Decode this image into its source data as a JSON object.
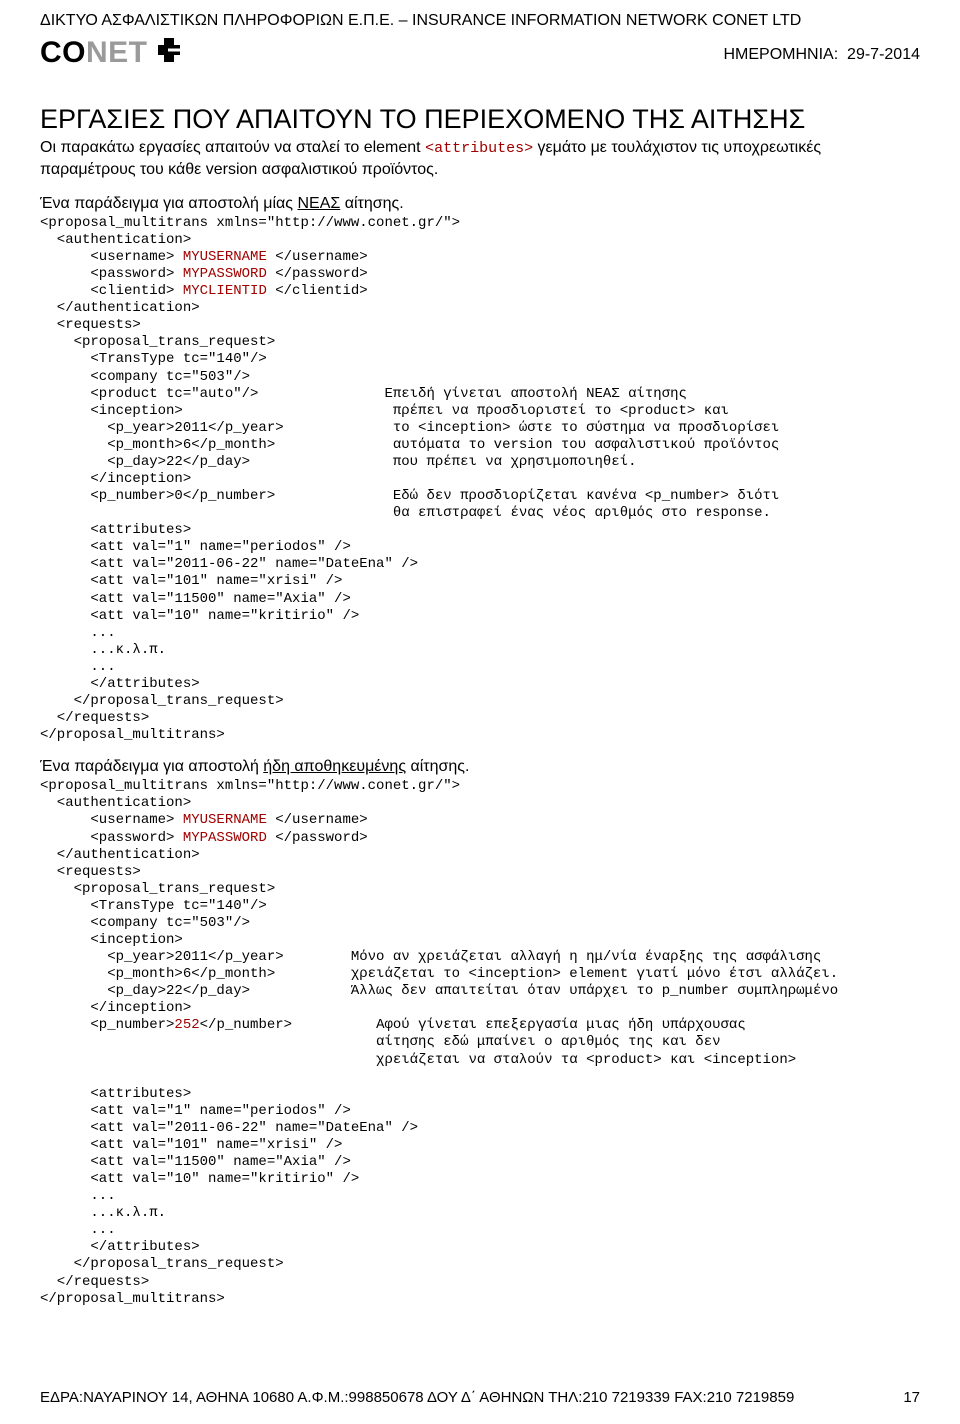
{
  "orgline": "ΔΙΚΤΥΟ ΑΣΦΑΛΙΣΤΙΚΩΝ ΠΛΗΡΟΦΟΡΙΩΝ Ε.Π.Ε. – INSURANCE INFORMATION NETWORK CONET LTD",
  "logo": {
    "part1": "CO",
    "part2": "NET"
  },
  "date": {
    "label": "ΗΜΕΡΟΜΗΝΙΑ:",
    "value": "29-7-2014"
  },
  "title": "ΕΡΓΑΣΙΕΣ ΠΟΥ ΑΠΑΙΤΟΥΝ ΤΟ ΠΕΡΙΕΧΟΜΕΝΟ ΤΗΣ ΑΙΤΗΣΗΣ",
  "intro": {
    "pre": "Οι παρακάτω εργασίες απαιτούν να σταλεί το element ",
    "code": "<attributes>",
    "post": " γεμάτο με τουλάχιστον τις υποχρεωτικές παραμέτρους του κάθε version ασφαλιστικού προϊόντος."
  },
  "example1": {
    "label_pre": "Ένα παράδειγμα για αποστολή μίας ",
    "label_u": "ΝΕΑΣ",
    "label_post": " αίτησης.",
    "code": "<proposal_multitrans xmlns=\"http://www.conet.gr/\">\n  <authentication>\n      <username> MYUSERNAME </username>\n      <password> MYPASSWORD </password>\n      <clientid> MYCLIENTID </clientid>\n  </authentication>\n  <requests>\n    <proposal_trans_request>\n      <TransType tc=\"140\"/>\n      <company tc=\"503\"/>\n      <product tc=\"auto\"/>               Επειδή γίνεται αποστολή ΝΕΑΣ αίτησης\n      <inception>                         πρέπει να προσδιοριστεί το <product> και\n        <p_year>2011</p_year>             το <inception> ώστε το σύστημα να προσδιορίσει\n        <p_month>6</p_month>              αυτόματα το version του ασφαλιστικού προϊόντος\n        <p_day>22</p_day>                 που πρέπει να χρησιμοποιηθεί.\n      </inception>\n      <p_number>0</p_number>              Εδώ δεν προσδιορίζεται κανένα <p_number> διότι\n                                          θα επιστραφεί ένας νέος αριθμός στο response.\n      <attributes>\n      <att val=\"1\" name=\"periodos\" />\n      <att val=\"2011-06-22\" name=\"DateEna\" />\n      <att val=\"101\" name=\"xrisi\" />\n      <att val=\"11500\" name=\"Axia\" />\n      <att val=\"10\" name=\"kritirio\" />\n      ...\n      ...κ.λ.π.\n      ...\n      </attributes>\n    </proposal_trans_request>\n  </requests>\n</proposal_multitrans>"
  },
  "example2": {
    "label_pre": "Ένα παράδειγμα για αποστολή ",
    "label_u": "ήδη αποθηκευμένης",
    "label_post": " αίτησης.",
    "code": "<proposal_multitrans xmlns=\"http://www.conet.gr/\">\n  <authentication>\n      <username> MYUSERNAME </username>\n      <password> MYPASSWORD </password>\n  </authentication>\n  <requests>\n    <proposal_trans_request>\n      <TransType tc=\"140\"/>\n      <company tc=\"503\"/>\n      <inception>\n        <p_year>2011</p_year>        Μόνο αν χρειάζεται αλλαγή η ημ/νία έναρξης της ασφάλισης\n        <p_month>6</p_month>         χρειάζεται το <inception> element γιατί μόνο έτσι αλλάζει.\n        <p_day>22</p_day>            Άλλως δεν απαιτείται όταν υπάρχει το p_number συμπληρωμένο\n      </inception>\n      <p_number>252</p_number>          Αφού γίνεται επεξεργασία μιας ήδη υπάρχουσας\n                                        αίτησης εδώ μπαίνει ο αριθμός της και δεν\n                                        χρειάζεται να σταλούν τα <product> και <inception>\n\n      <attributes>\n      <att val=\"1\" name=\"periodos\" />\n      <att val=\"2011-06-22\" name=\"DateEna\" />\n      <att val=\"101\" name=\"xrisi\" />\n      <att val=\"11500\" name=\"Axia\" />\n      <att val=\"10\" name=\"kritirio\" />\n      ...\n      ...κ.λ.π.\n      ...\n      </attributes>\n    </proposal_trans_request>\n  </requests>\n</proposal_multitrans>"
  },
  "footer": {
    "address": "ΕΔΡΑ:ΝΑΥΑΡΙΝΟΥ 14, ΑΘΗΝΑ 10680 Α.Φ.Μ.:998850678 ΔΟΥ Δ΄ ΑΘΗΝΩΝ ΤΗΛ:210 7219339 FAX:210 7219859",
    "page": "17"
  },
  "red_tokens": [
    "MYUSERNAME",
    "MYPASSWORD",
    "MYCLIENTID",
    "252"
  ]
}
